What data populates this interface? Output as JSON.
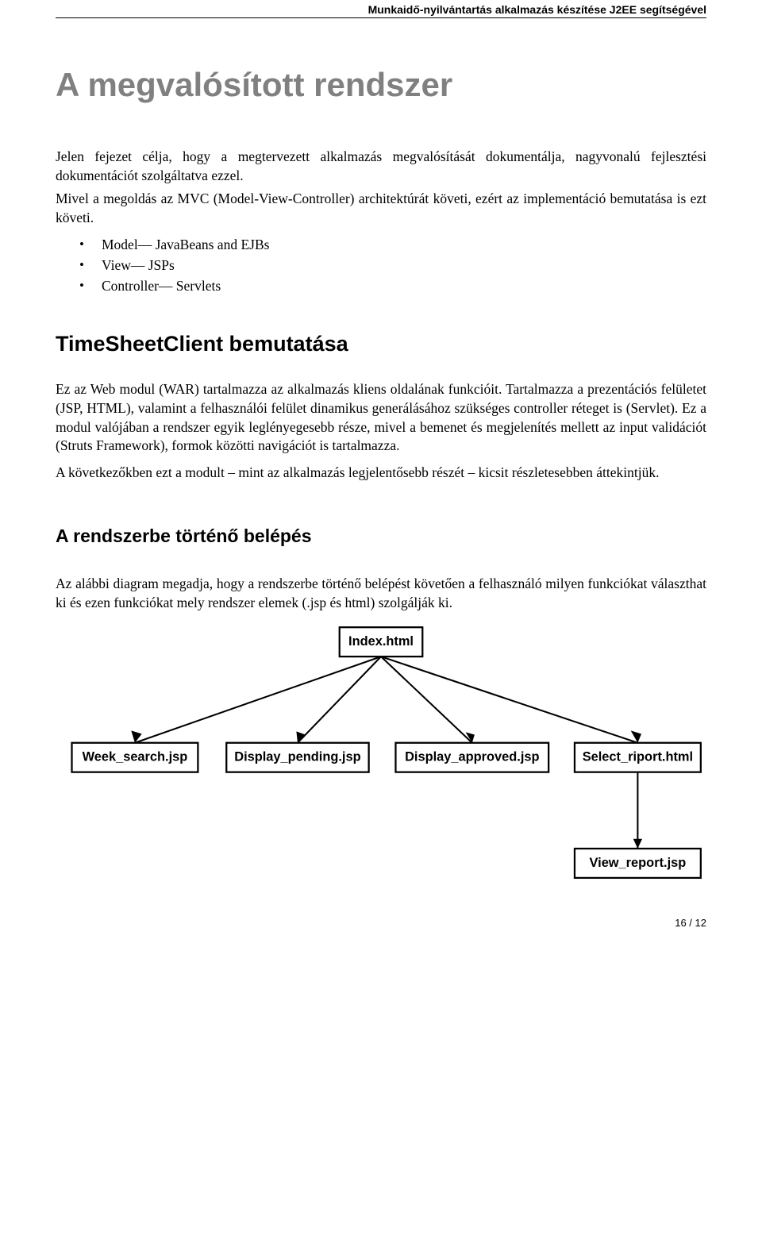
{
  "header": {
    "text": "Munkaidő-nyilvántartás alkalmazás készítése J2EE segítségével"
  },
  "title": "A megvalósított rendszer",
  "intro_para": "Jelen fejezet célja, hogy a megtervezett alkalmazás megvalósítását dokumentálja, nagyvonalú fejlesztési dokumentációt szolgáltatva ezzel.",
  "mvc_para": "Mivel a megoldás az MVC (Model-View-Controller) architektúrát követi, ezért az implementáció bemutatása is ezt követi.",
  "bullets": [
    "Model— JavaBeans and EJBs",
    "View— JSPs",
    "Controller— Servlets"
  ],
  "section2_heading": "TimeSheetClient bemutatása",
  "section2_para1": "Ez az Web modul (WAR) tartalmazza az alkalmazás kliens oldalának funkcióit. Tartalmazza a prezentációs felületet (JSP, HTML), valamint a felhasználói felület dinamikus generálásához szükséges controller réteget is (Servlet). Ez a modul valójában a rendszer egyik leglényegesebb része, mivel a bemenet és megjelenítés mellett az input validációt (Struts Framework), formok közötti navigációt is tartalmazza.",
  "section2_para2": "A következőkben ezt a modult – mint az alkalmazás legjelentősebb részét – kicsit részletesebben áttekintjük.",
  "section3_heading": "A rendszerbe történő belépés",
  "section3_para": "Az alábbi diagram megadja, hogy a rendszerbe történő belépést követően a felhasználó milyen funkciókat választhat ki és ezen funkciókat mely rendszer elemek (.jsp és html) szolgálják ki.",
  "diagram": {
    "root": "Index.html",
    "children": [
      "Week_search.jsp",
      "Display_pending.jsp",
      "Display_approved.jsp",
      "Select_riport.html"
    ],
    "leaf_parent_index": 3,
    "leaf": "View_report.jsp"
  },
  "footer": "16 / 12"
}
